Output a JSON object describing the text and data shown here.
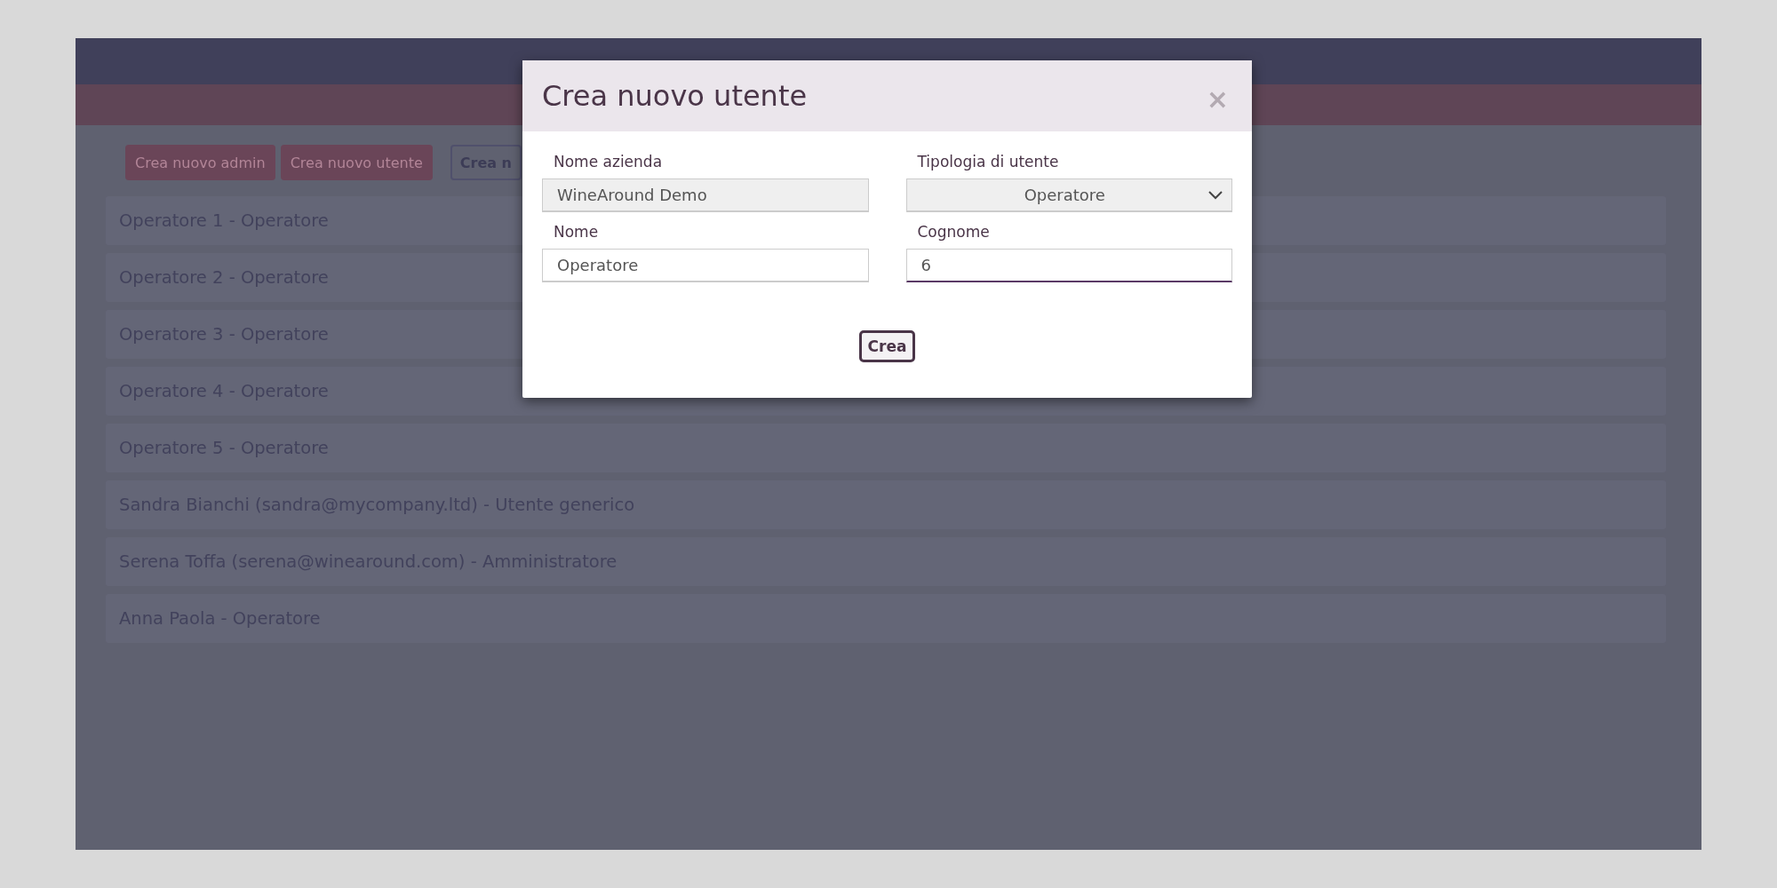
{
  "actions": [
    {
      "label": "Crea nuovo admin",
      "kind": "filled"
    },
    {
      "label": "Crea nuovo utente",
      "kind": "filled"
    },
    {
      "label": "Crea n",
      "kind": "outline"
    }
  ],
  "users": [
    "Operatore 1 - Operatore",
    "Operatore 2 - Operatore",
    "Operatore 3 - Operatore",
    "Operatore 4 - Operatore",
    "Operatore 5 - Operatore",
    "Sandra Bianchi (sandra@mycompany.ltd) - Utente generico",
    "Serena Toffa (serena@winearound.com) - Amministratore",
    "Anna Paola - Operatore"
  ],
  "dialog": {
    "title": "Crea nuovo utente",
    "close": "×",
    "fields": [
      {
        "label": "Nome azienda",
        "kind": "text",
        "value": "WineAround Demo",
        "disabled": true,
        "focused": false
      },
      {
        "label": "Tipologia di utente",
        "kind": "select",
        "value": "Operatore",
        "focused": false
      },
      {
        "label": "Nome",
        "kind": "text",
        "value": "Operatore",
        "disabled": false,
        "focused": false
      },
      {
        "label": "Cognome",
        "kind": "text",
        "value": "6",
        "disabled": false,
        "focused": true
      }
    ],
    "submit": "Crea"
  }
}
